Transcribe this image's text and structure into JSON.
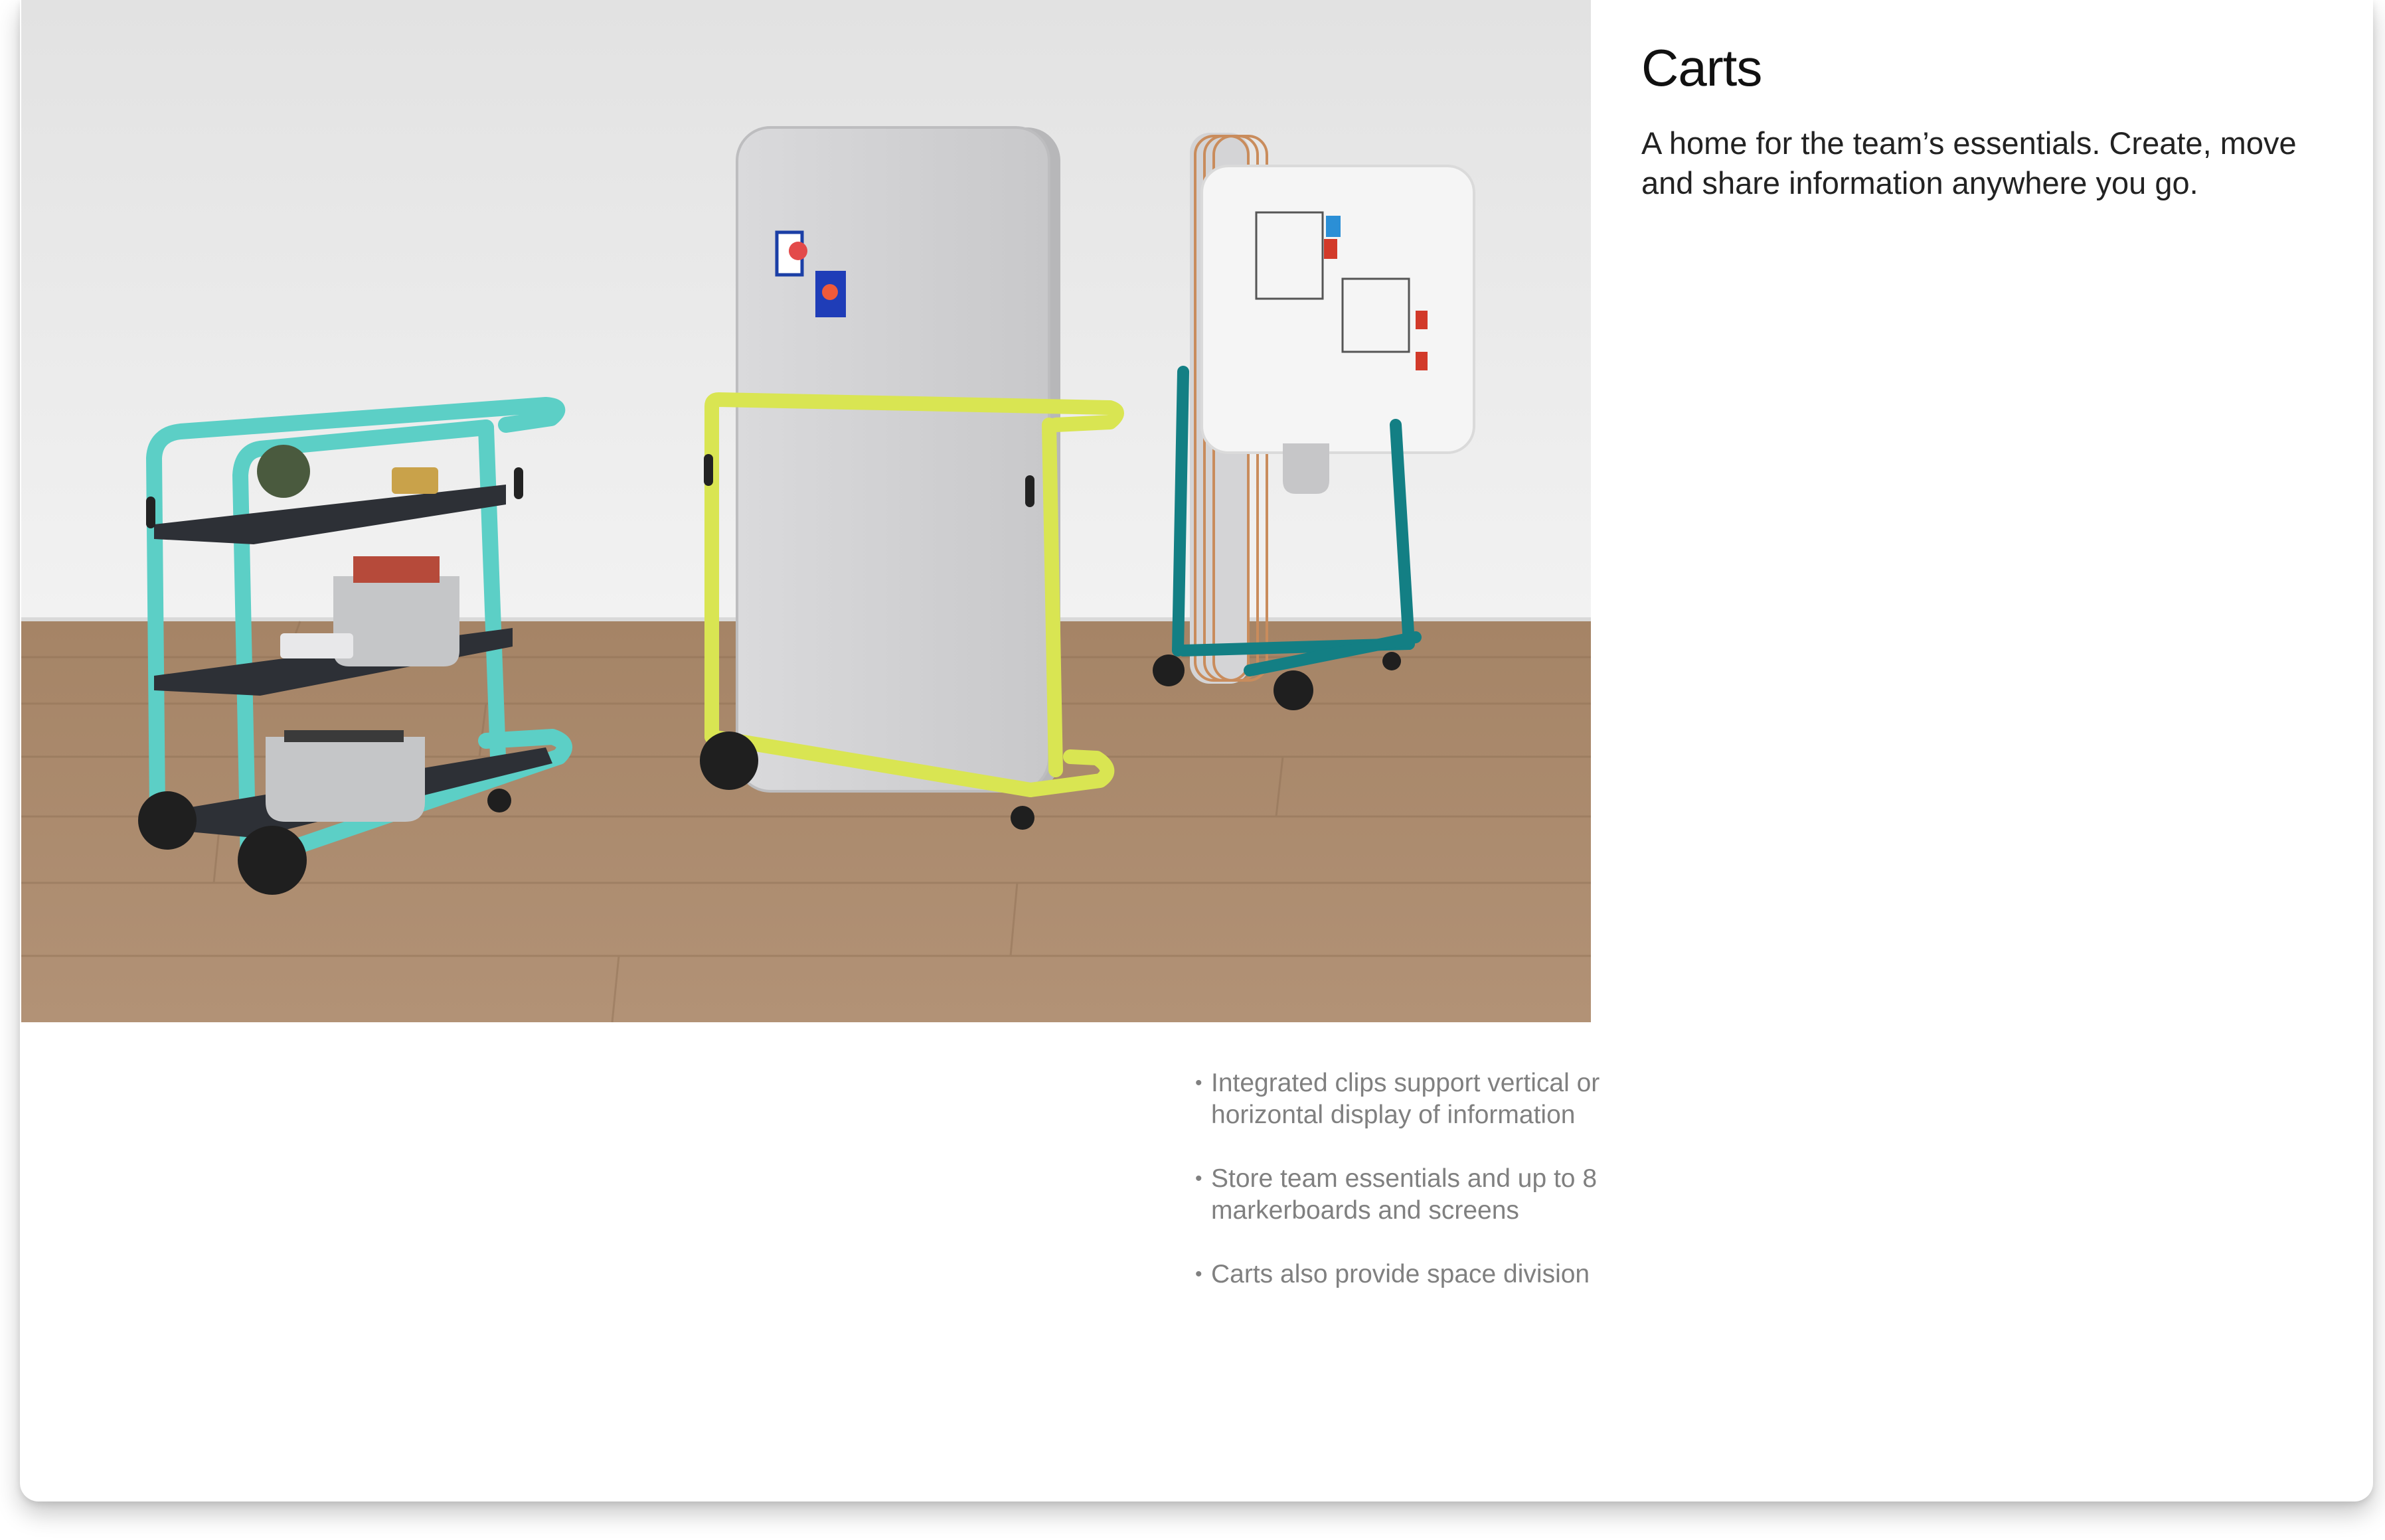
{
  "product": {
    "title": "Carts",
    "subtitle": "A home for the team’s essentials. Create, move and share information anywhere you go."
  },
  "photo": {
    "subject": "three-mobile-carts",
    "colors": {
      "wall": "#ebebeb",
      "floor": "#a98a6b",
      "aqua_cart": "#5ccfc6",
      "lime_cart": "#d9e552",
      "teal_cart": "#137f84",
      "shelf": "#2d3036",
      "panel": "#d6d6d8",
      "felt": "#c5c6c8"
    }
  },
  "features": {
    "bullet_glyph": "•",
    "items": [
      "Integrated clips support vertical or horizontal display of information",
      "Store team essentials and up to 8 markerboards and screens",
      "Carts also provide space division"
    ]
  }
}
